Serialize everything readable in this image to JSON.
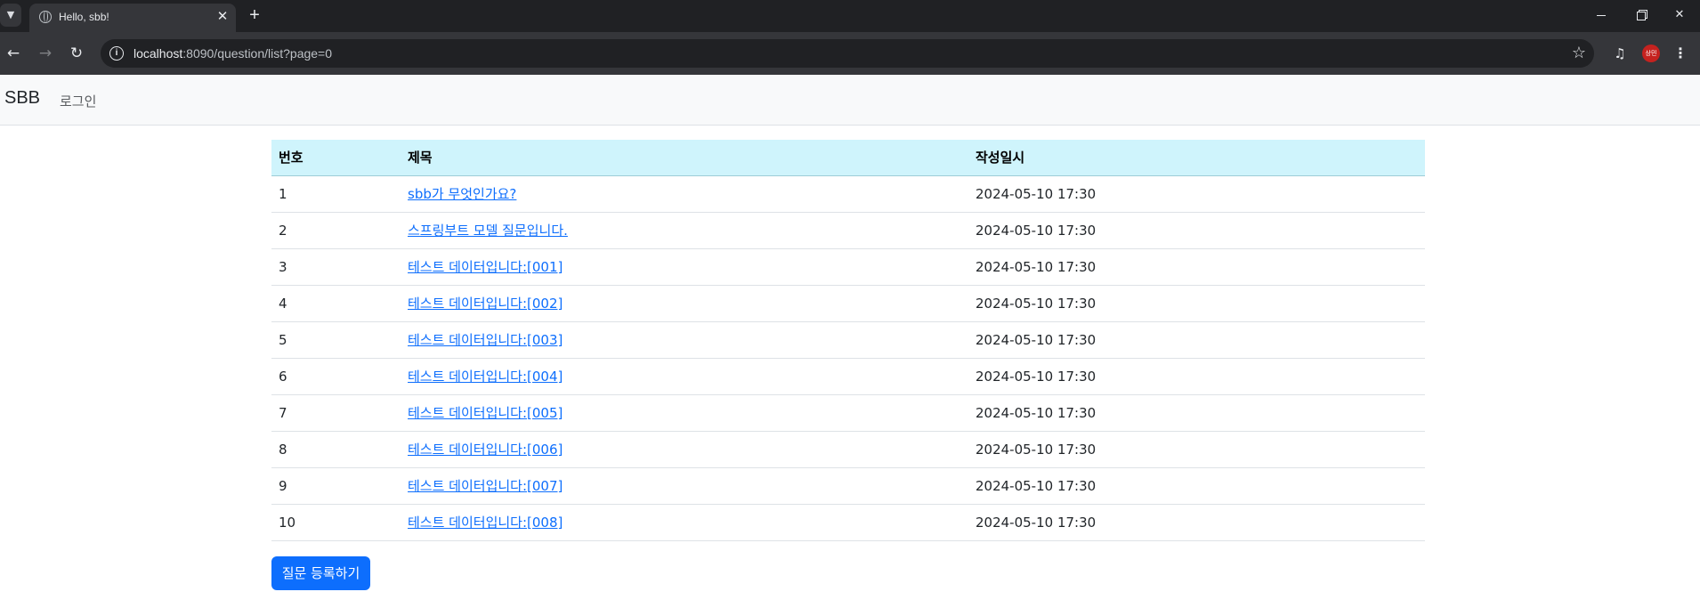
{
  "browser": {
    "tab_title": "Hello, sbb!",
    "url_host": "localhost",
    "url_rest": ":8090/question/list?page=0",
    "icons": {
      "tab_search": "chevron-down-icon",
      "favicon": "globe-icon",
      "close": "close-icon",
      "new_tab": "plus-icon",
      "back": "arrow-left-icon",
      "forward": "arrow-right-icon",
      "reload": "reload-icon",
      "site_info": "info-icon",
      "bookmark": "star-icon",
      "media": "media-control-icon",
      "menu": "kebab-menu-icon"
    },
    "profile_label": "상민",
    "profile_color": "#c5221f"
  },
  "navbar": {
    "brand": "SBB",
    "login": "로그인"
  },
  "table": {
    "headers": [
      "번호",
      "제목",
      "작성일시"
    ],
    "rows": [
      {
        "no": "1",
        "subject": "sbb가 무엇인가요?",
        "date": "2024-05-10 17:30"
      },
      {
        "no": "2",
        "subject": "스프링부트 모델 질문입니다.",
        "date": "2024-05-10 17:30"
      },
      {
        "no": "3",
        "subject": "테스트 데이터입니다:[001]",
        "date": "2024-05-10 17:30"
      },
      {
        "no": "4",
        "subject": "테스트 데이터입니다:[002]",
        "date": "2024-05-10 17:30"
      },
      {
        "no": "5",
        "subject": "테스트 데이터입니다:[003]",
        "date": "2024-05-10 17:30"
      },
      {
        "no": "6",
        "subject": "테스트 데이터입니다:[004]",
        "date": "2024-05-10 17:30"
      },
      {
        "no": "7",
        "subject": "테스트 데이터입니다:[005]",
        "date": "2024-05-10 17:30"
      },
      {
        "no": "8",
        "subject": "테스트 데이터입니다:[006]",
        "date": "2024-05-10 17:30"
      },
      {
        "no": "9",
        "subject": "테스트 데이터입니다:[007]",
        "date": "2024-05-10 17:30"
      },
      {
        "no": "10",
        "subject": "테스트 데이터입니다:[008]",
        "date": "2024-05-10 17:30"
      }
    ]
  },
  "register_button": "질문 등록하기",
  "colors": {
    "header_bg": "#cff4fc",
    "link": "#0d6efd",
    "button_bg": "#0d6efd",
    "navbar_bg": "#f8f9fa"
  }
}
